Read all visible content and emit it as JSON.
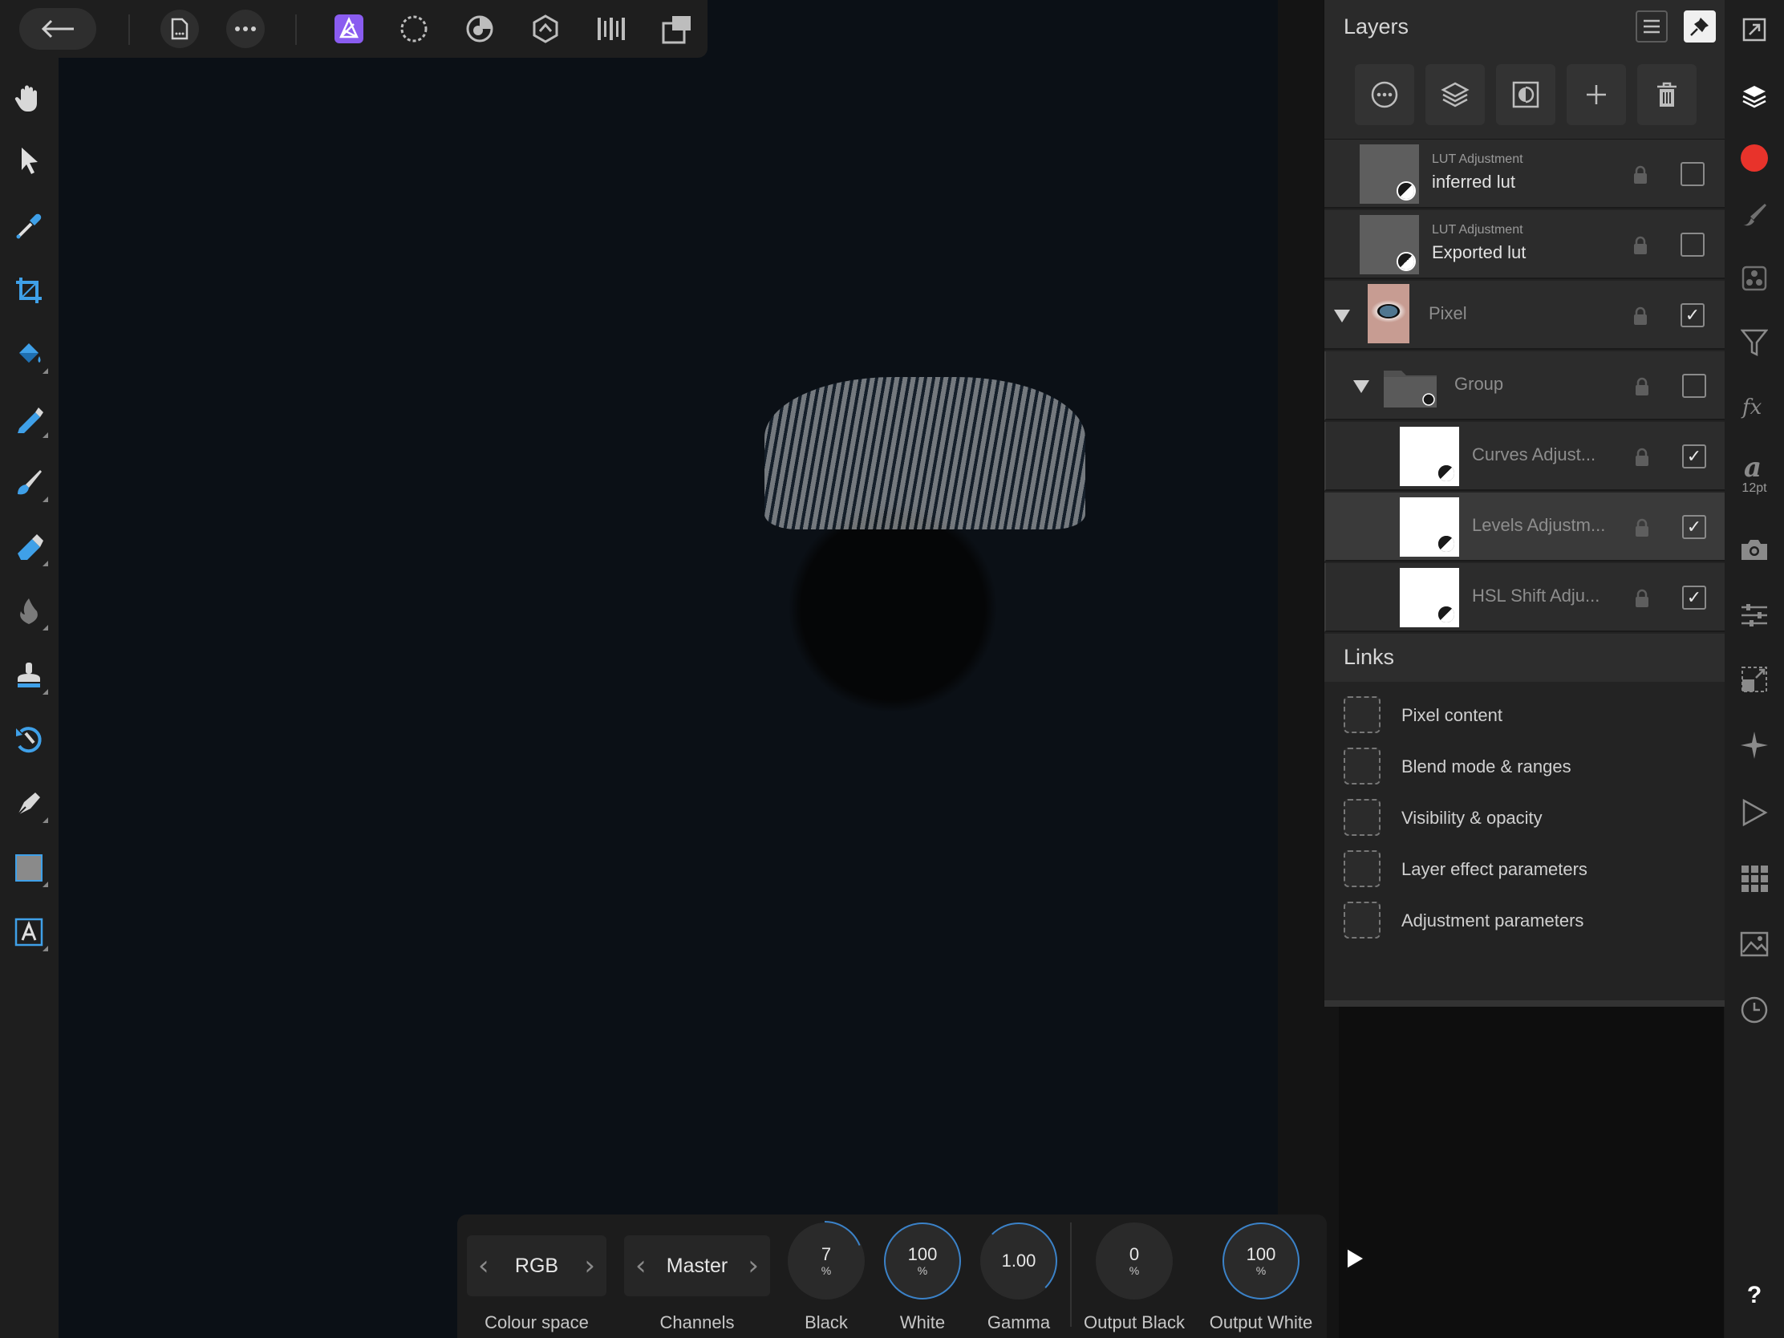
{
  "layers_panel": {
    "title": "Layers",
    "layers": [
      {
        "type": "LUT Adjustment",
        "name": "inferred lut",
        "visible": false
      },
      {
        "type": "LUT Adjustment",
        "name": "Exported lut",
        "visible": false
      },
      {
        "type": "",
        "name": "Pixel",
        "visible": true
      },
      {
        "type": "",
        "name": "Group",
        "visible": false
      },
      {
        "type": "",
        "name": "Curves Adjust...",
        "visible": true
      },
      {
        "type": "",
        "name": "Levels Adjustm...",
        "visible": true
      },
      {
        "type": "",
        "name": "HSL Shift Adju...",
        "visible": true
      }
    ],
    "check_mark": "✓"
  },
  "links": {
    "title": "Links",
    "items": [
      "Pixel content",
      "Blend mode & ranges",
      "Visibility & opacity",
      "Layer effect parameters",
      "Adjustment parameters"
    ]
  },
  "context_bar": {
    "colour_space": {
      "value": "RGB",
      "label": "Colour space"
    },
    "channels": {
      "value": "Master",
      "label": "Channels"
    },
    "black": {
      "value": "7",
      "unit": "%",
      "label": "Black"
    },
    "white": {
      "value": "100",
      "unit": "%",
      "label": "White"
    },
    "gamma": {
      "value": "1.00",
      "label": "Gamma"
    },
    "output_black": {
      "value": "0",
      "unit": "%",
      "label": "Output Black"
    },
    "output_white": {
      "value": "100",
      "unit": "%",
      "label": "Output White"
    },
    "chev_left": "‹",
    "chev_right": "›"
  },
  "right_toolbar": {
    "text_size": "12pt",
    "help": "?"
  },
  "colors": {
    "accent": "#3b82c8",
    "persona_active": "#8a5cf0",
    "colour_swatch": "#e8332b"
  }
}
